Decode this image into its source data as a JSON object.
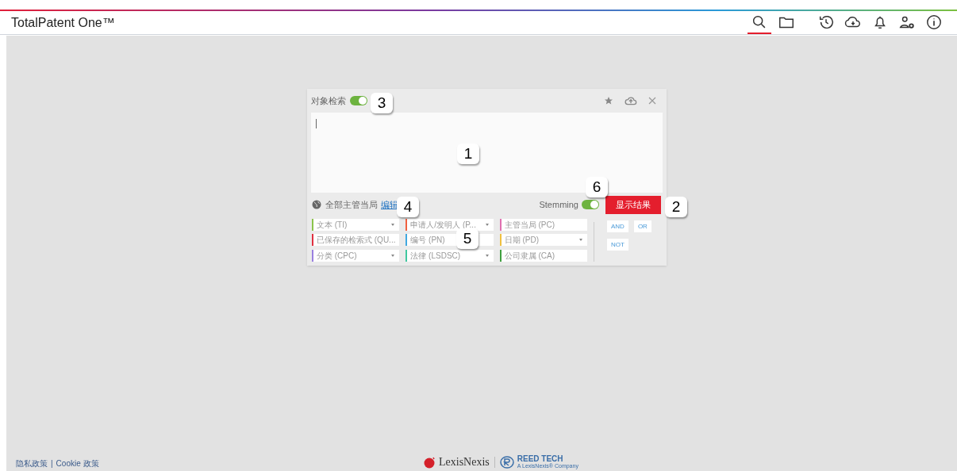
{
  "app": {
    "title": "TotalPatent One™"
  },
  "nav_icons": [
    {
      "kind": "search",
      "selected": true
    },
    {
      "kind": "folder",
      "selected": false
    },
    {
      "kind": "history",
      "selected": false
    },
    {
      "kind": "cloud",
      "selected": false
    },
    {
      "kind": "bell",
      "selected": false
    },
    {
      "kind": "user-settings",
      "selected": false
    },
    {
      "kind": "info",
      "selected": false
    }
  ],
  "search_panel": {
    "object_search_label": "对象检索",
    "object_search_on": true,
    "scope_label": "全部主管当局",
    "edit_link": "编辑",
    "stemming_label": "Stemming",
    "stemming_on": true,
    "submit": "显示结果",
    "fields": [
      {
        "label": "文本 (TI)",
        "color": "#8bc34a",
        "kind": "dropdown"
      },
      {
        "label": "申请人/发明人 (P...",
        "color": "#f06040",
        "kind": "dropdown"
      },
      {
        "label": "主管当局 (PC)",
        "color": "#e070b0",
        "kind": "text"
      },
      {
        "label": "已保存的检索式 (QU...",
        "color": "#e03040",
        "kind": "text"
      },
      {
        "label": "编号 (PN)",
        "color": "#40a8e0",
        "kind": "text"
      },
      {
        "label": "日期 (PD)",
        "color": "#f0c040",
        "kind": "dropdown"
      },
      {
        "label": "分类 (CPC)",
        "color": "#9a80e0",
        "kind": "dropdown"
      },
      {
        "label": "法律 (LSDSC)",
        "color": "#40c8a0",
        "kind": "dropdown"
      },
      {
        "label": "公司隶属 (CA)",
        "color": "#40a040",
        "kind": "text"
      }
    ],
    "operators": [
      "AND",
      "OR",
      "NOT"
    ]
  },
  "callouts": [
    "3",
    "1",
    "4",
    "6",
    "2",
    "5"
  ],
  "footer": {
    "privacy": "隐私政策",
    "separator": "|",
    "cookie": "Cookie 政策",
    "lexisnexis": "LexisNexis",
    "reedtech": "REED TECH",
    "reedtech_sub": "A LexisNexis® Company"
  }
}
